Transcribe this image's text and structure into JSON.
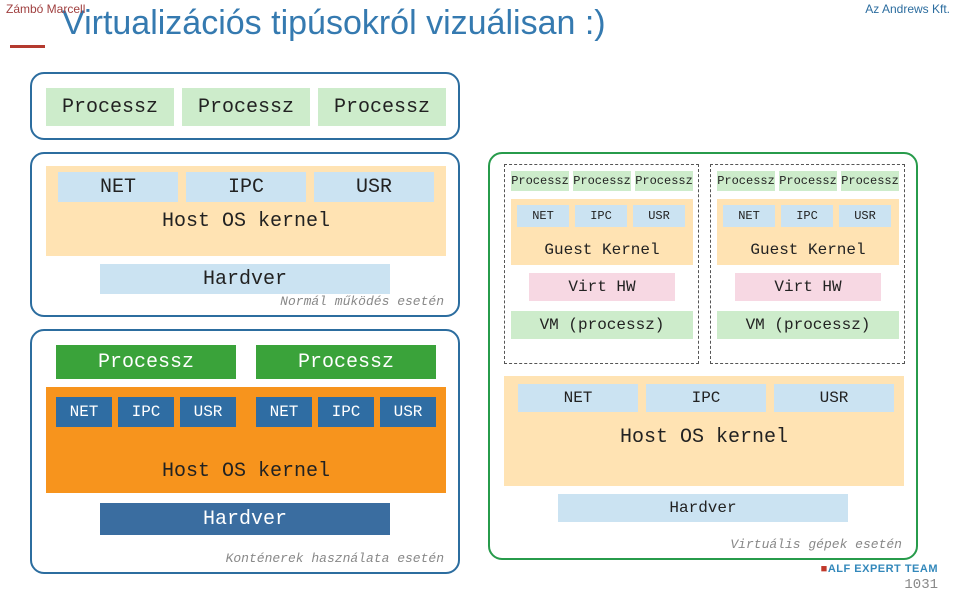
{
  "meta": {
    "author": "Zámbó Marcell",
    "company": "Az Andrews Kft.",
    "title": "Virtualizációs tipúsokról vizuálisan :)",
    "page_number": "1031",
    "footer_logo": "ALF EXPERT TEAM"
  },
  "panelA": {
    "proc1": "Processz",
    "proc2": "Processz",
    "proc3": "Processz"
  },
  "panelB": {
    "net": "NET",
    "ipc": "IPC",
    "usr": "USR",
    "kernel": "Host OS kernel",
    "hw": "Hardver",
    "caption": "Normál működés esetén"
  },
  "panelC": {
    "left_proc": "Processz",
    "right_proc": "Processz",
    "l_net": "NET",
    "l_ipc": "IPC",
    "l_usr": "USR",
    "r_net": "NET",
    "r_ipc": "IPC",
    "r_usr": "USR",
    "kernel": "Host OS kernel",
    "hw": "Hardver",
    "caption": "Konténerek használata esetén"
  },
  "panelD": {
    "vm1": {
      "p1": "Processz",
      "p2": "Processz",
      "p3": "Processz",
      "net": "NET",
      "ipc": "IPC",
      "usr": "USR",
      "gk": "Guest Kernel",
      "vhw": "Virt HW",
      "vm": "VM (processz)"
    },
    "vm2": {
      "p1": "Processz",
      "p2": "Processz",
      "p3": "Processz",
      "net": "NET",
      "ipc": "IPC",
      "usr": "USR",
      "gk": "Guest Kernel",
      "vhw": "Virt HW",
      "vm": "VM (processz)"
    },
    "host": {
      "net": "NET",
      "ipc": "IPC",
      "usr": "USR",
      "kernel": "Host OS kernel",
      "hw": "Hardver"
    },
    "caption": "Virtuális gépek esetén"
  }
}
